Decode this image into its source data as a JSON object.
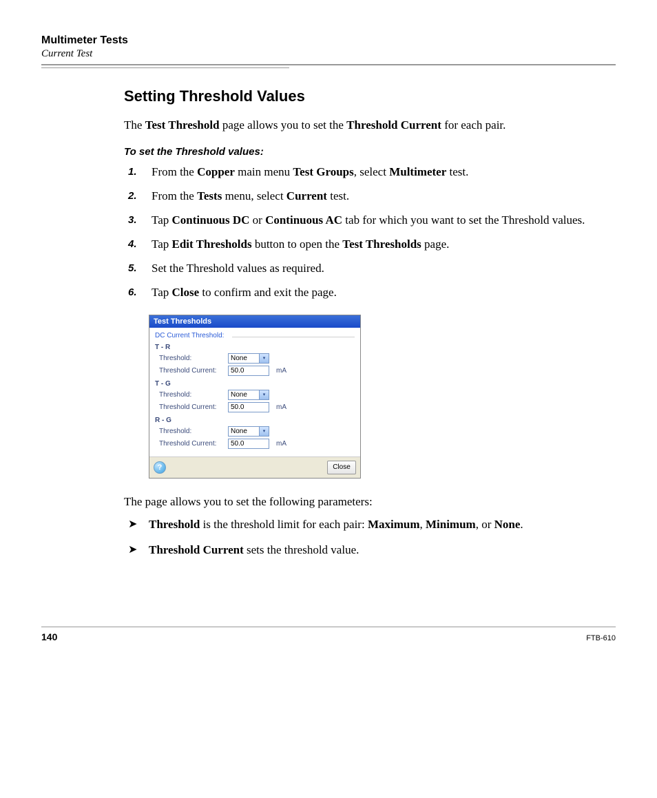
{
  "header": {
    "chapter": "Multimeter Tests",
    "section": "Current Test"
  },
  "title": "Setting Threshold Values",
  "intro": {
    "p1a": "The ",
    "p1b": "Test Threshold",
    "p1c": " page allows you to set the ",
    "p1d": "Threshold Current",
    "p1e": " for each pair."
  },
  "procedure_title": "To set the Threshold values:",
  "steps": {
    "s1": {
      "a": "From the ",
      "b": "Copper",
      "c": " main menu ",
      "d": "Test Groups",
      "e": ", select ",
      "f": "Multimeter",
      "g": " test."
    },
    "s2": {
      "a": "From the ",
      "b": "Tests",
      "c": " menu, select ",
      "d": "Current",
      "e": " test."
    },
    "s3": {
      "a": "Tap ",
      "b": "Continuous DC",
      "c": " or ",
      "d": "Continuous AC",
      "e": " tab for which you want to set the Threshold values."
    },
    "s4": {
      "a": "Tap ",
      "b": "Edit Thresholds",
      "c": " button to open the ",
      "d": "Test Thresholds",
      "e": " page."
    },
    "s5": {
      "a": "Set the Threshold values as required."
    },
    "s6": {
      "a": "Tap ",
      "b": "Close",
      "c": " to confirm and exit the page."
    }
  },
  "screenshot": {
    "title": "Test Thresholds",
    "legend": "DC Current Threshold:",
    "groups": [
      {
        "name": "T - R",
        "threshold_label": "Threshold:",
        "threshold_value": "None",
        "current_label": "Threshold Current:",
        "current_value": "50.0",
        "unit": "mA"
      },
      {
        "name": "T - G",
        "threshold_label": "Threshold:",
        "threshold_value": "None",
        "current_label": "Threshold Current:",
        "current_value": "50.0",
        "unit": "mA"
      },
      {
        "name": "R - G",
        "threshold_label": "Threshold:",
        "threshold_value": "None",
        "current_label": "Threshold Current:",
        "current_value": "50.0",
        "unit": "mA"
      }
    ],
    "help": "?",
    "close": "Close"
  },
  "after": "The page allows you to set the following parameters:",
  "bullets": {
    "b1": {
      "a": "Threshold",
      "b": " is the threshold limit for each pair: ",
      "c": "Maximum",
      "d": ", ",
      "e": "Minimum",
      "f": ", or ",
      "g": "None",
      "h": "."
    },
    "b2": {
      "a": "Threshold Current",
      "b": " sets the threshold value."
    }
  },
  "footer": {
    "page": "140",
    "doc": "FTB-610"
  }
}
